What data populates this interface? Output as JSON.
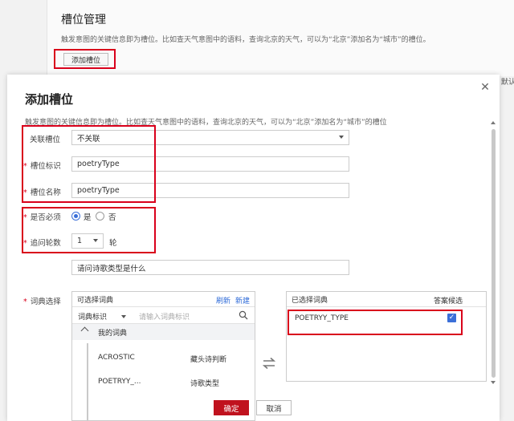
{
  "background": {
    "title": "槽位管理",
    "description": "触发意图的关键信息即为槽位。比如查天气意图中的语料，查询北京的天气，可以为“北京”添加名为“城市”的槽位。",
    "add_button": "添加槽位",
    "right_text": "/ 默认"
  },
  "modal": {
    "title": "添加槽位",
    "description": "触发意图的关键信息即为槽位。比如查天气意图中的语料，查询北京的天气，可以为“北京”添加名为“城市”的槽位",
    "required_mark": "*",
    "fields": {
      "linked_slot": {
        "label": "关联槽位",
        "value": "不关联"
      },
      "slot_id": {
        "label": "槽位标识",
        "value": "poetryType"
      },
      "slot_name": {
        "label": "槽位名称",
        "value": "poetryType"
      },
      "required": {
        "label": "是否必须",
        "option_yes": "是",
        "option_no": "否",
        "selected": "是"
      },
      "rounds": {
        "label": "追问轮数",
        "value": "1",
        "unit": "轮"
      },
      "prompt": {
        "value": "请问诗歌类型是什么"
      },
      "dictionary": {
        "label": "词典选择"
      }
    },
    "available_panel": {
      "title": "可选择词典",
      "refresh": "刷新",
      "create": "新建",
      "filter_select": "词典标识",
      "search_placeholder": "请输入词典标识",
      "group": "我的词典",
      "items": [
        {
          "id": "ACROSTIC",
          "name": "藏头诗判断"
        },
        {
          "id": "POETRYY_...",
          "name": "诗歌类型"
        }
      ]
    },
    "selected_panel": {
      "title": "已选择词典",
      "column": "答案候选",
      "items": [
        {
          "id": "POETRYY_TYPE"
        }
      ]
    },
    "confirm": "确定",
    "cancel": "取消"
  },
  "colors": {
    "primary_red": "#c0121e",
    "link_blue": "#2f6bd8",
    "annotation_red": "#d9001b"
  }
}
